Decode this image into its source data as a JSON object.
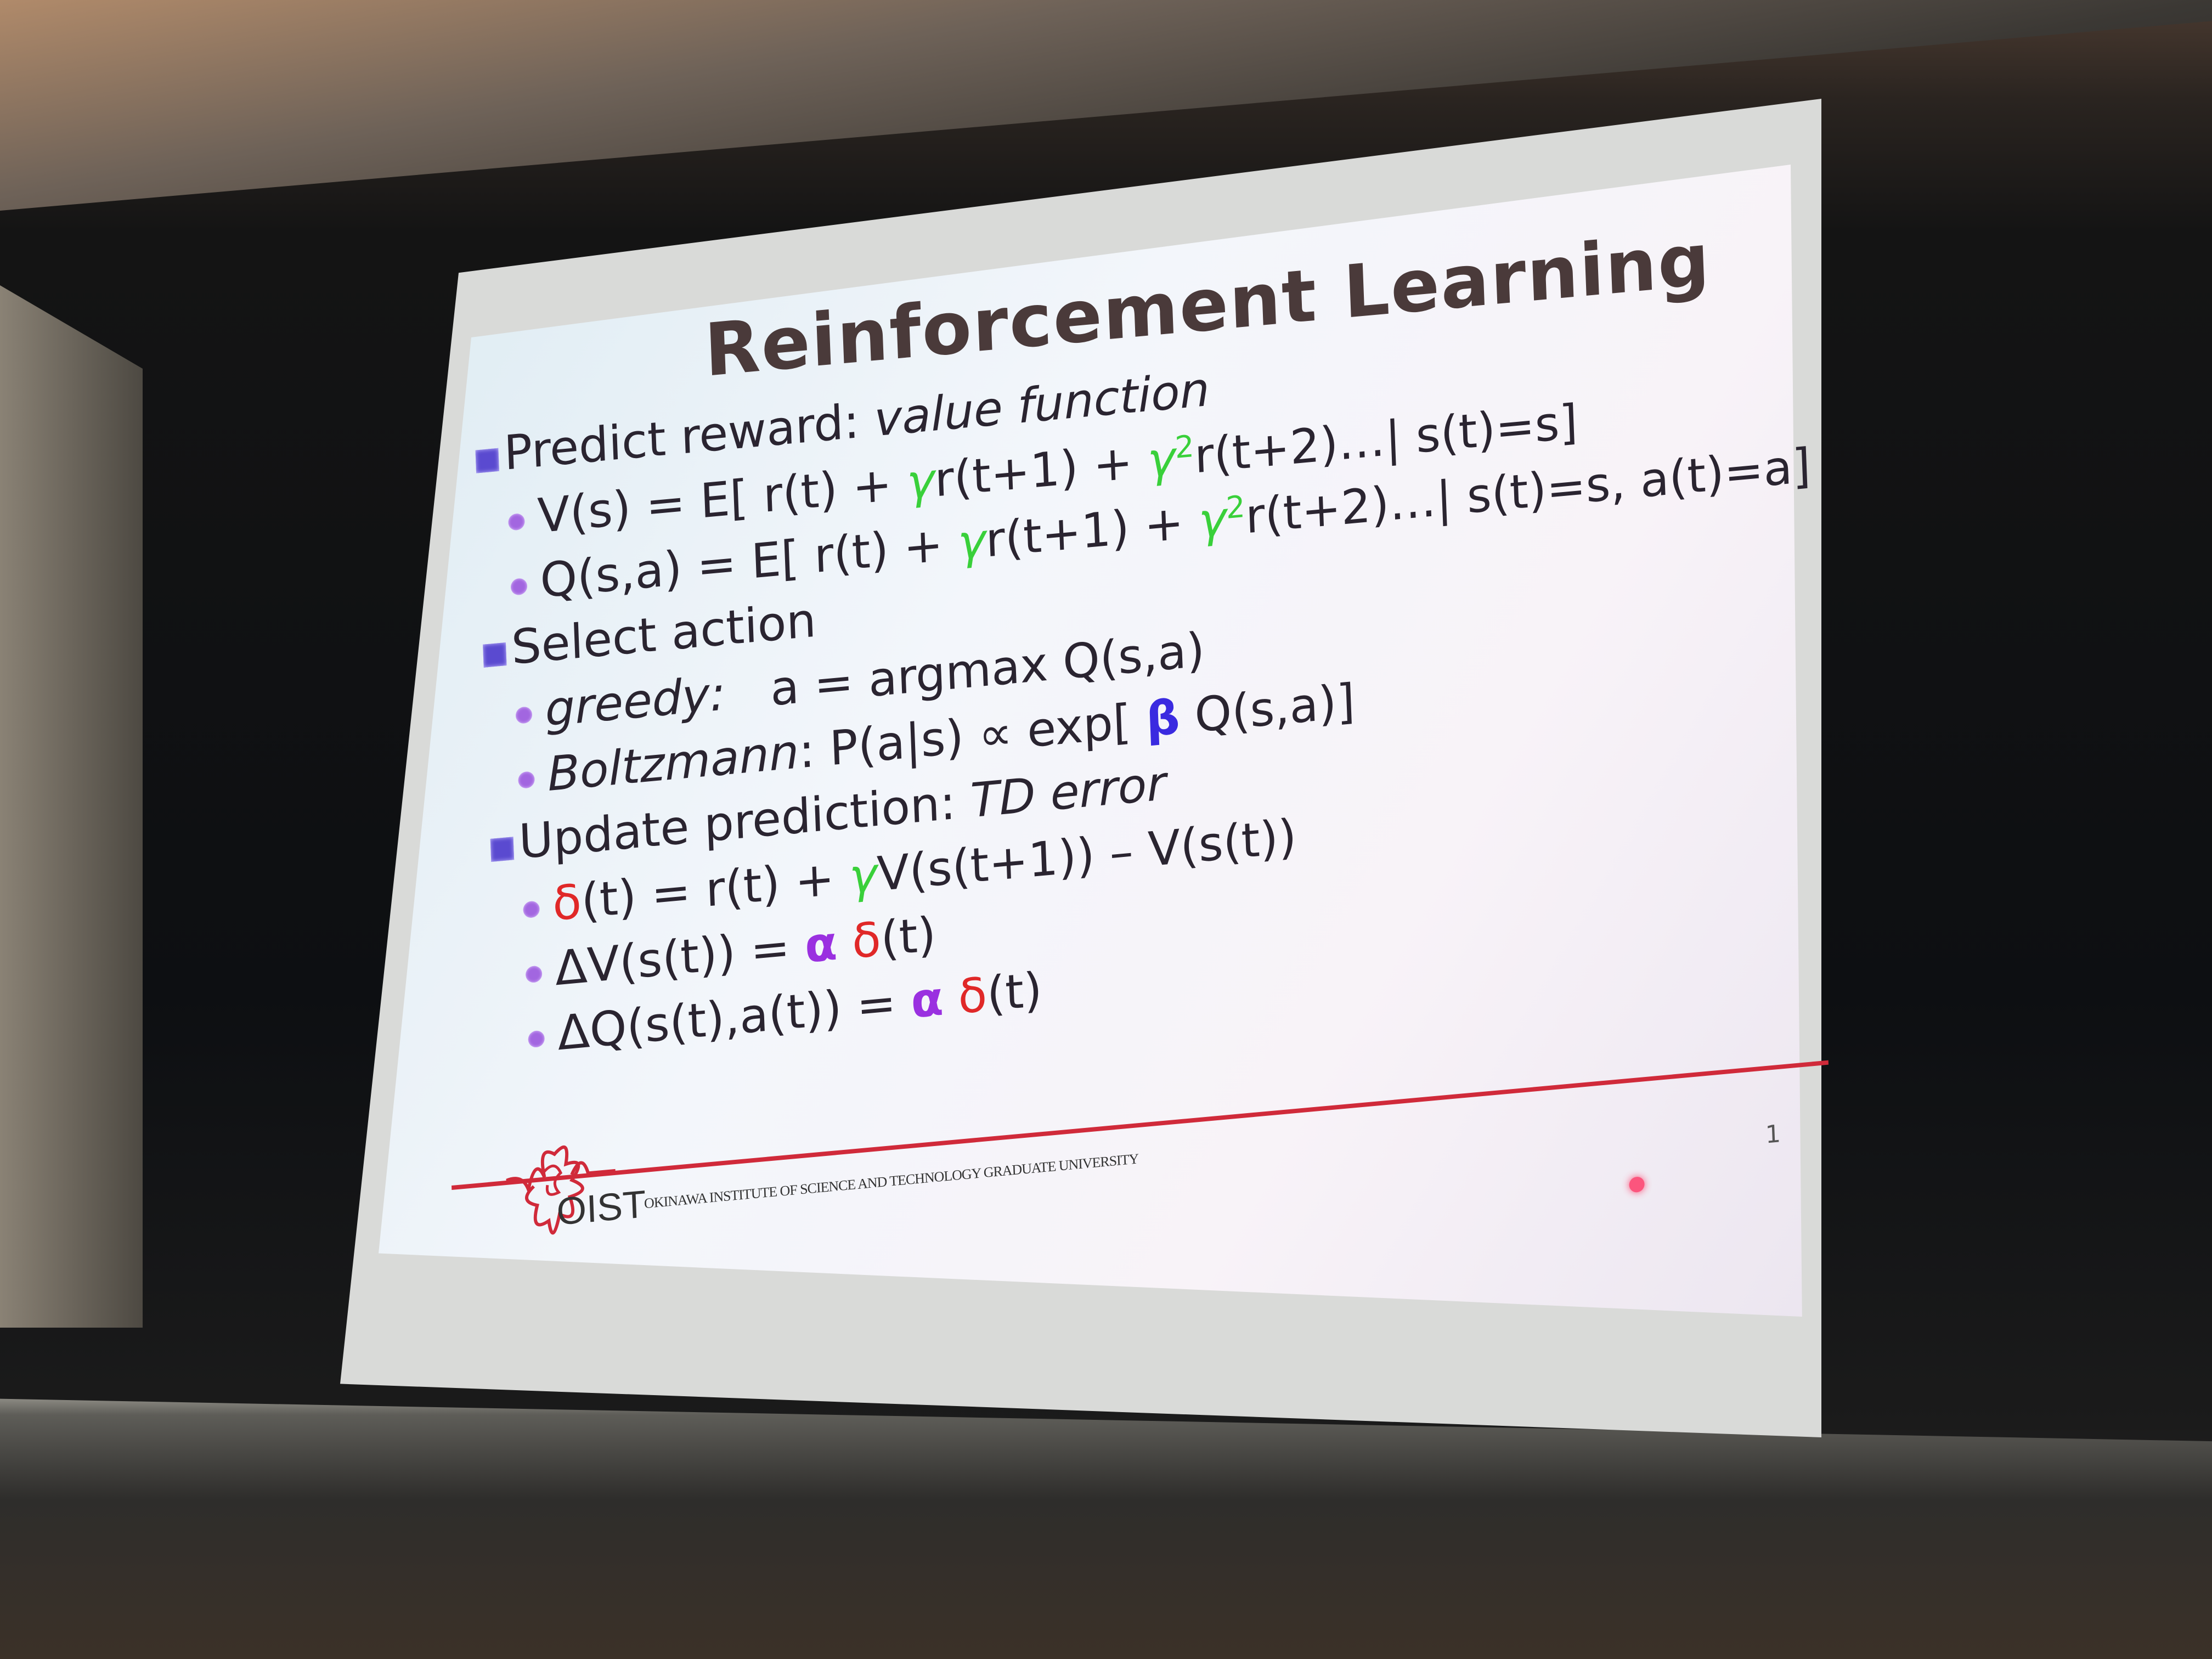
{
  "slide": {
    "title": "Reinforcement Learning",
    "lines": [
      {
        "level": 1,
        "segments": [
          {
            "t": "Predict reward: "
          },
          {
            "t": "value function",
            "i": true
          }
        ]
      },
      {
        "level": 2,
        "segments": [
          {
            "t": "V(s) = E[ r(t) + "
          },
          {
            "t": "γ",
            "c": "#39d03a",
            "i": true
          },
          {
            "t": "r(t+1) + "
          },
          {
            "t": "γ",
            "c": "#39d03a",
            "i": true
          },
          {
            "t": "2",
            "c": "#39d03a",
            "sup": true
          },
          {
            "t": "r(t+2)…| s(t)=s]"
          }
        ]
      },
      {
        "level": 2,
        "segments": [
          {
            "t": "Q(s,a) = E[ r(t) + "
          },
          {
            "t": "γ",
            "c": "#39d03a",
            "i": true
          },
          {
            "t": "r(t+1) + "
          },
          {
            "t": "γ",
            "c": "#39d03a",
            "i": true
          },
          {
            "t": "2",
            "c": "#39d03a",
            "sup": true
          },
          {
            "t": "r(t+2)…| s(t)=s, a(t)=a]"
          }
        ]
      },
      {
        "level": 1,
        "segments": [
          {
            "t": "Select action"
          }
        ]
      },
      {
        "level": 2,
        "segments": [
          {
            "t": "greedy:",
            "i": true
          },
          {
            "t": "   a = argmax Q(s,a)"
          }
        ]
      },
      {
        "level": 2,
        "segments": [
          {
            "t": "Boltzmann",
            "i": true
          },
          {
            "t": ": P(a|s) ∝ exp[ "
          },
          {
            "t": "β",
            "c": "#3a2ae0",
            "b": true
          },
          {
            "t": " Q(s,a)]"
          }
        ]
      },
      {
        "level": 1,
        "segments": [
          {
            "t": "Update prediction: "
          },
          {
            "t": "TD error",
            "i": true
          }
        ]
      },
      {
        "level": 2,
        "segments": [
          {
            "t": "δ",
            "c": "#e02828"
          },
          {
            "t": "(t) = r(t) + "
          },
          {
            "t": "γ",
            "c": "#39d03a",
            "i": true
          },
          {
            "t": "V(s(t+1)) – V(s(t))"
          }
        ]
      },
      {
        "level": 2,
        "segments": [
          {
            "t": "ΔV(s(t)) = "
          },
          {
            "t": "α",
            "c": "#9a30e0",
            "b": true
          },
          {
            "t": " "
          },
          {
            "t": "δ",
            "c": "#e02828"
          },
          {
            "t": "(t)"
          }
        ]
      },
      {
        "level": 2,
        "segments": [
          {
            "t": "ΔQ(s(t),a(t)) = "
          },
          {
            "t": "α",
            "c": "#9a30e0",
            "b": true
          },
          {
            "t": " "
          },
          {
            "t": "δ",
            "c": "#e02828"
          },
          {
            "t": "(t)"
          }
        ]
      }
    ],
    "footer": {
      "logo_text": "OIST",
      "institution": "OKINAWA INSTITUTE OF SCIENCE AND TECHNOLOGY GRADUATE UNIVERSITY",
      "page_number": "1"
    }
  },
  "colors": {
    "accent_red": "#d02a3a",
    "gamma": "#39d03a",
    "beta": "#3a2ae0",
    "alpha": "#9a30e0",
    "delta": "#e02828",
    "bullet_square": "#5a4ad0",
    "bullet_dot": "#a266e0"
  }
}
